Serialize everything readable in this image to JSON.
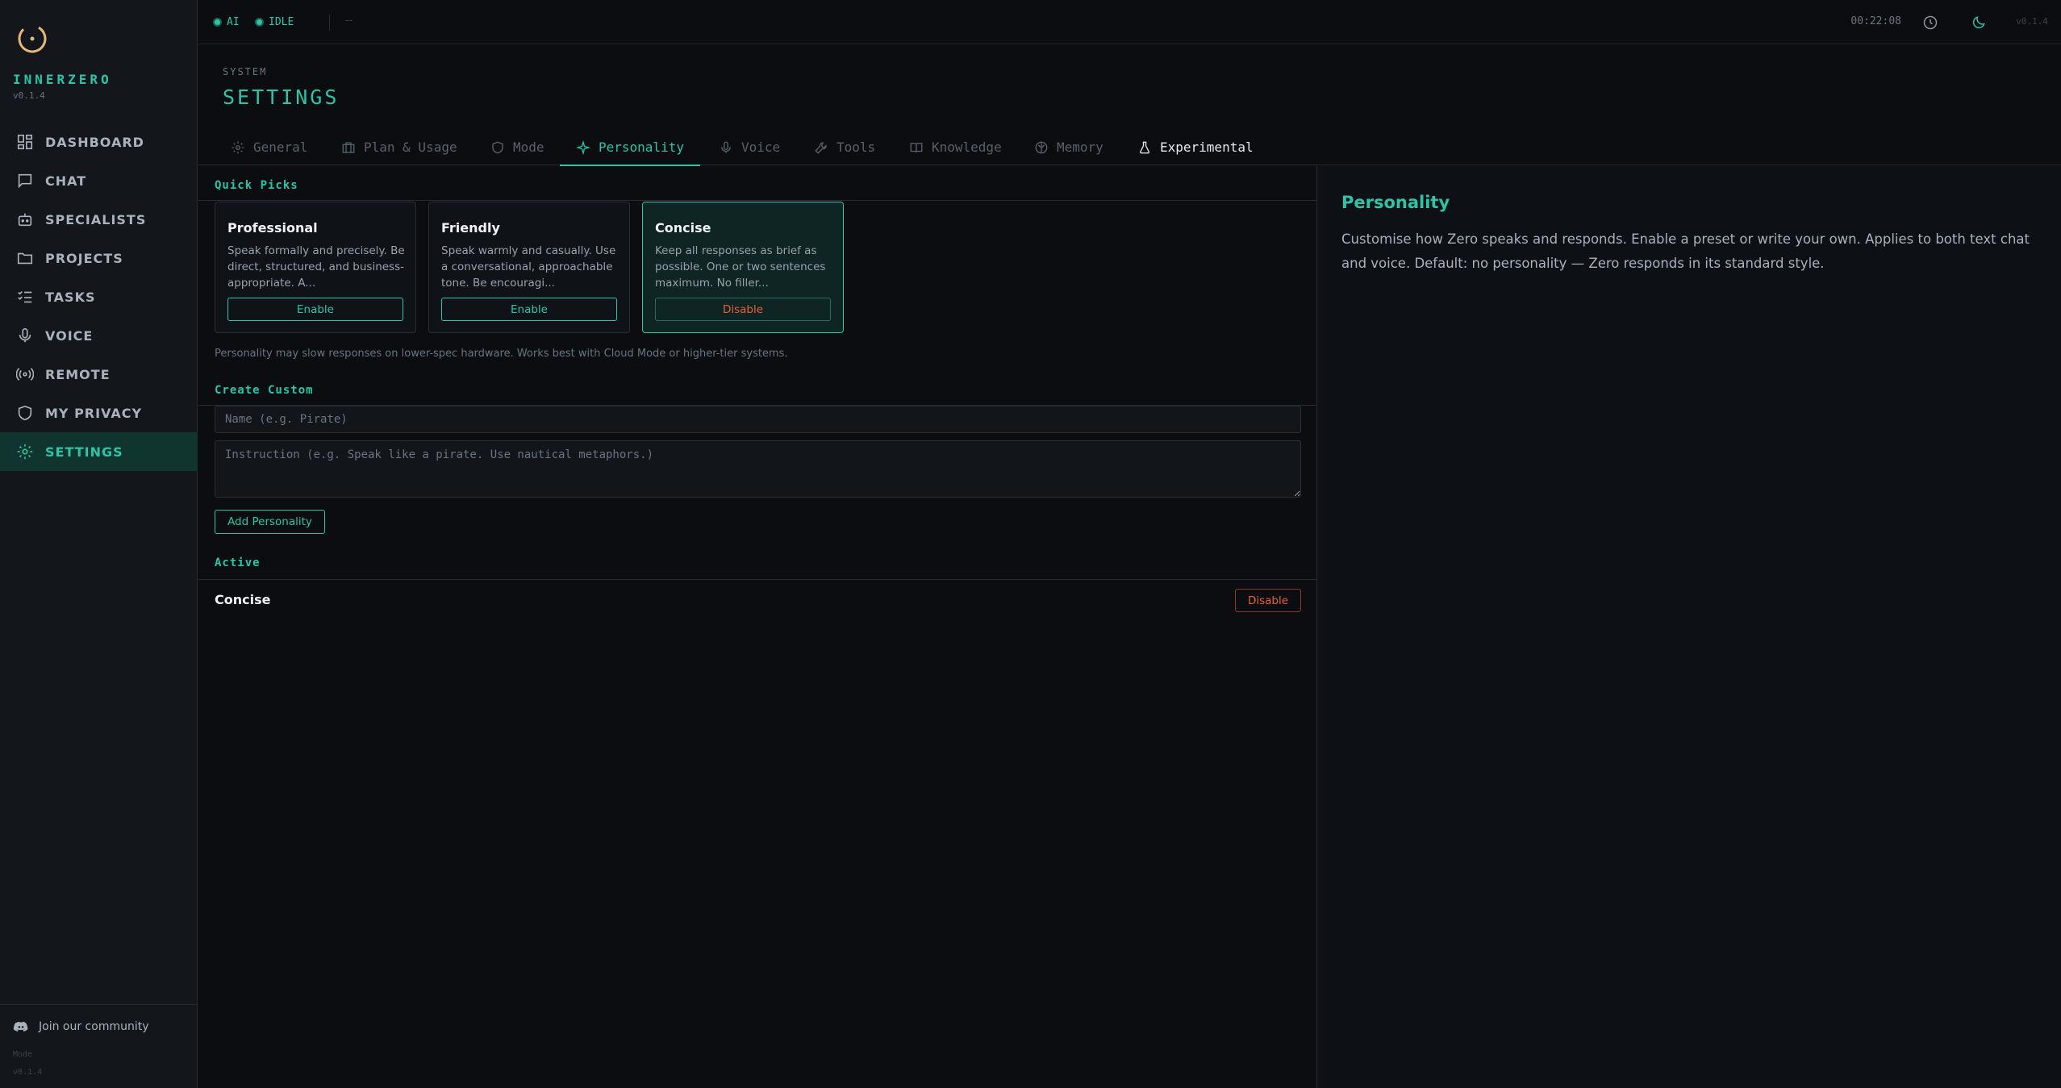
{
  "app": {
    "brand": "INNERZERO",
    "version": "v0.1.4"
  },
  "sidebar": {
    "items": [
      {
        "label": "DASHBOARD",
        "icon": "dashboard-icon"
      },
      {
        "label": "CHAT",
        "icon": "chat-icon"
      },
      {
        "label": "SPECIALISTS",
        "icon": "robot-icon"
      },
      {
        "label": "PROJECTS",
        "icon": "folder-icon"
      },
      {
        "label": "TASKS",
        "icon": "checklist-icon"
      },
      {
        "label": "VOICE",
        "icon": "microphone-icon"
      },
      {
        "label": "REMOTE",
        "icon": "broadcast-icon"
      },
      {
        "label": "MY PRIVACY",
        "icon": "shield-icon"
      },
      {
        "label": "SETTINGS",
        "icon": "gear-icon",
        "active": true
      }
    ],
    "community": "Join our community",
    "bottom_mode": "Mode",
    "bottom_version": "v0.1.4"
  },
  "topbar": {
    "status_ai": "AI",
    "status_idle": "IDLE",
    "dash": "--",
    "clock": "00:22:08",
    "version": "v0.1.4"
  },
  "header": {
    "section": "SYSTEM",
    "title": "SETTINGS"
  },
  "tabs": [
    {
      "label": "General",
      "icon": "gear-icon"
    },
    {
      "label": "Plan & Usage",
      "icon": "briefcase-icon"
    },
    {
      "label": "Mode",
      "icon": "shield-icon"
    },
    {
      "label": "Personality",
      "icon": "sparkle-icon",
      "active": true
    },
    {
      "label": "Voice",
      "icon": "microphone-icon"
    },
    {
      "label": "Tools",
      "icon": "wrench-icon"
    },
    {
      "label": "Knowledge",
      "icon": "book-icon"
    },
    {
      "label": "Memory",
      "icon": "brain-icon"
    },
    {
      "label": "Experimental",
      "icon": "flask-icon"
    }
  ],
  "quick_picks": {
    "title": "Quick Picks",
    "cards": [
      {
        "title": "Professional",
        "desc": "Speak formally and precisely. Be direct, structured, and business-appropriate. A...",
        "button": "Enable",
        "selected": false
      },
      {
        "title": "Friendly",
        "desc": "Speak warmly and casually. Use a conversational, approachable tone. Be encouragi...",
        "button": "Enable",
        "selected": false
      },
      {
        "title": "Concise",
        "desc": "Keep all responses as brief as possible. One or two sentences maximum. No filler...",
        "button": "Disable",
        "selected": true
      }
    ],
    "hint": "Personality may slow responses on lower-spec hardware. Works best with Cloud Mode or higher-tier systems."
  },
  "custom": {
    "title": "Create Custom",
    "name_placeholder": "Name (e.g. Pirate)",
    "instruction_placeholder": "Instruction (e.g. Speak like a pirate. Use nautical metaphors.)",
    "add_button": "Add Personality"
  },
  "active": {
    "title": "Active",
    "name": "Concise",
    "disable_button": "Disable"
  },
  "info": {
    "title": "Personality",
    "text": "Customise how Zero speaks and responds. Enable a preset or write your own. Applies to both text chat and voice. Default: no personality — Zero responds in its standard style."
  },
  "colors": {
    "accent": "#2ec4a8",
    "danger": "#e8603c",
    "background": "#0b0d11",
    "sidebar": "#13161b"
  }
}
